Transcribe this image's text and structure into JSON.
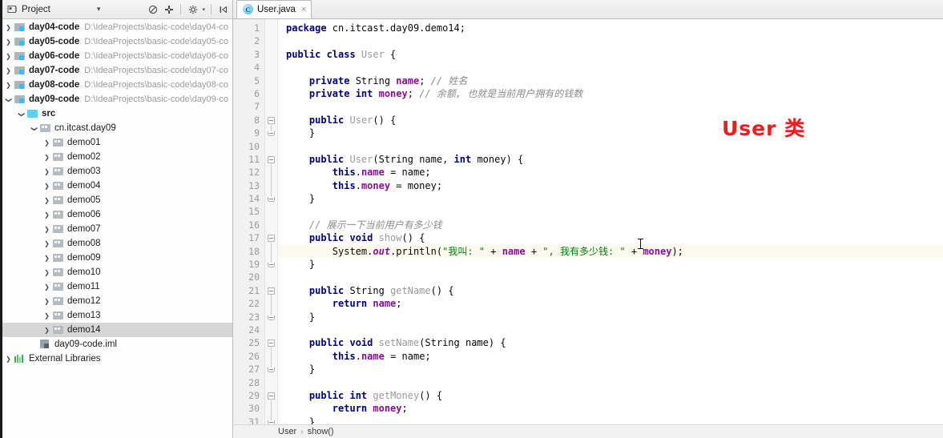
{
  "project_panel": {
    "title": "Project",
    "title_dropdown": "▾",
    "toolbar": [
      {
        "name": "collapse-all-icon",
        "glyph": "⊘"
      },
      {
        "name": "locate-target-icon",
        "glyph": "✥"
      },
      {
        "name": "settings-gear-icon",
        "glyph": "⚙"
      },
      {
        "name": "hide-panel-icon",
        "glyph": "⊢"
      }
    ],
    "tree": [
      {
        "label": "day04-code",
        "path": "D:\\IdeaProjects\\basic-code\\day04-co",
        "indent": 0,
        "twisty": "collapsed",
        "icon": "module",
        "bold": true,
        "selected": false
      },
      {
        "label": "day05-code",
        "path": "D:\\IdeaProjects\\basic-code\\day05-co",
        "indent": 0,
        "twisty": "collapsed",
        "icon": "module",
        "bold": true,
        "selected": false
      },
      {
        "label": "day06-code",
        "path": "D:\\IdeaProjects\\basic-code\\day06-co",
        "indent": 0,
        "twisty": "collapsed",
        "icon": "module",
        "bold": true,
        "selected": false
      },
      {
        "label": "day07-code",
        "path": "D:\\IdeaProjects\\basic-code\\day07-co",
        "indent": 0,
        "twisty": "collapsed",
        "icon": "module",
        "bold": true,
        "selected": false
      },
      {
        "label": "day08-code",
        "path": "D:\\IdeaProjects\\basic-code\\day08-co",
        "indent": 0,
        "twisty": "collapsed",
        "icon": "module",
        "bold": true,
        "selected": false
      },
      {
        "label": "day09-code",
        "path": "D:\\IdeaProjects\\basic-code\\day09-co",
        "indent": 0,
        "twisty": "expanded",
        "icon": "module",
        "bold": true,
        "selected": false
      },
      {
        "label": "src",
        "path": "",
        "indent": 1,
        "twisty": "expanded",
        "icon": "src",
        "bold": true,
        "selected": false
      },
      {
        "label": "cn.itcast.day09",
        "path": "",
        "indent": 2,
        "twisty": "expanded",
        "icon": "pkg",
        "bold": false,
        "selected": false
      },
      {
        "label": "demo01",
        "path": "",
        "indent": 3,
        "twisty": "collapsed",
        "icon": "pkg",
        "bold": false,
        "selected": false
      },
      {
        "label": "demo02",
        "path": "",
        "indent": 3,
        "twisty": "collapsed",
        "icon": "pkg",
        "bold": false,
        "selected": false
      },
      {
        "label": "demo03",
        "path": "",
        "indent": 3,
        "twisty": "collapsed",
        "icon": "pkg",
        "bold": false,
        "selected": false
      },
      {
        "label": "demo04",
        "path": "",
        "indent": 3,
        "twisty": "collapsed",
        "icon": "pkg",
        "bold": false,
        "selected": false
      },
      {
        "label": "demo05",
        "path": "",
        "indent": 3,
        "twisty": "collapsed",
        "icon": "pkg",
        "bold": false,
        "selected": false
      },
      {
        "label": "demo06",
        "path": "",
        "indent": 3,
        "twisty": "collapsed",
        "icon": "pkg",
        "bold": false,
        "selected": false
      },
      {
        "label": "demo07",
        "path": "",
        "indent": 3,
        "twisty": "collapsed",
        "icon": "pkg",
        "bold": false,
        "selected": false
      },
      {
        "label": "demo08",
        "path": "",
        "indent": 3,
        "twisty": "collapsed",
        "icon": "pkg",
        "bold": false,
        "selected": false
      },
      {
        "label": "demo09",
        "path": "",
        "indent": 3,
        "twisty": "collapsed",
        "icon": "pkg",
        "bold": false,
        "selected": false
      },
      {
        "label": "demo10",
        "path": "",
        "indent": 3,
        "twisty": "collapsed",
        "icon": "pkg",
        "bold": false,
        "selected": false
      },
      {
        "label": "demo11",
        "path": "",
        "indent": 3,
        "twisty": "collapsed",
        "icon": "pkg",
        "bold": false,
        "selected": false
      },
      {
        "label": "demo12",
        "path": "",
        "indent": 3,
        "twisty": "collapsed",
        "icon": "pkg",
        "bold": false,
        "selected": false
      },
      {
        "label": "demo13",
        "path": "",
        "indent": 3,
        "twisty": "collapsed",
        "icon": "pkg",
        "bold": false,
        "selected": false
      },
      {
        "label": "demo14",
        "path": "",
        "indent": 3,
        "twisty": "collapsed",
        "icon": "pkg",
        "bold": false,
        "selected": true
      },
      {
        "label": "day09-code.iml",
        "path": "",
        "indent": 2,
        "twisty": "none",
        "icon": "iml",
        "bold": false,
        "selected": false
      },
      {
        "label": "External Libraries",
        "path": "",
        "indent": 0,
        "twisty": "collapsed",
        "icon": "lib",
        "bold": false,
        "selected": false
      }
    ]
  },
  "editor": {
    "tab": {
      "label": "User.java",
      "class_icon_letter": "C",
      "close_glyph": "×"
    },
    "annotation": "User 类",
    "annotation_color": "#ee1c1c",
    "highlighted_line": 18,
    "lines": [
      {
        "n": 1,
        "tokens": [
          {
            "t": "package ",
            "c": "kw"
          },
          {
            "t": "cn.itcast.day09.demo14;",
            "c": "plain"
          }
        ]
      },
      {
        "n": 2,
        "tokens": []
      },
      {
        "n": 3,
        "tokens": [
          {
            "t": "public class ",
            "c": "kw"
          },
          {
            "t": "User ",
            "c": "cls"
          },
          {
            "t": "{",
            "c": "plain"
          }
        ]
      },
      {
        "n": 4,
        "tokens": []
      },
      {
        "n": 5,
        "tokens": [
          {
            "t": "    ",
            "c": "plain"
          },
          {
            "t": "private ",
            "c": "kw"
          },
          {
            "t": "String ",
            "c": "plain"
          },
          {
            "t": "name",
            "c": "fld"
          },
          {
            "t": "; ",
            "c": "plain"
          },
          {
            "t": "// 姓名",
            "c": "cmt"
          }
        ]
      },
      {
        "n": 6,
        "tokens": [
          {
            "t": "    ",
            "c": "plain"
          },
          {
            "t": "private int ",
            "c": "kw"
          },
          {
            "t": "money",
            "c": "fld"
          },
          {
            "t": "; ",
            "c": "plain"
          },
          {
            "t": "// 余额, 也就是当前用户拥有的钱数",
            "c": "cmt"
          }
        ]
      },
      {
        "n": 7,
        "tokens": []
      },
      {
        "n": 8,
        "tokens": [
          {
            "t": "    ",
            "c": "plain"
          },
          {
            "t": "public ",
            "c": "kw"
          },
          {
            "t": "User",
            "c": "cls"
          },
          {
            "t": "() {",
            "c": "plain"
          }
        ]
      },
      {
        "n": 9,
        "tokens": [
          {
            "t": "    }",
            "c": "plain"
          }
        ]
      },
      {
        "n": 10,
        "tokens": []
      },
      {
        "n": 11,
        "tokens": [
          {
            "t": "    ",
            "c": "plain"
          },
          {
            "t": "public ",
            "c": "kw"
          },
          {
            "t": "User",
            "c": "cls"
          },
          {
            "t": "(String name, ",
            "c": "plain"
          },
          {
            "t": "int ",
            "c": "kw"
          },
          {
            "t": "money) {",
            "c": "plain"
          }
        ]
      },
      {
        "n": 12,
        "tokens": [
          {
            "t": "        ",
            "c": "plain"
          },
          {
            "t": "this",
            "c": "kw"
          },
          {
            "t": ".",
            "c": "plain"
          },
          {
            "t": "name",
            "c": "fld"
          },
          {
            "t": " = name;",
            "c": "plain"
          }
        ]
      },
      {
        "n": 13,
        "tokens": [
          {
            "t": "        ",
            "c": "plain"
          },
          {
            "t": "this",
            "c": "kw"
          },
          {
            "t": ".",
            "c": "plain"
          },
          {
            "t": "money",
            "c": "fld"
          },
          {
            "t": " = money;",
            "c": "plain"
          }
        ]
      },
      {
        "n": 14,
        "tokens": [
          {
            "t": "    }",
            "c": "plain"
          }
        ]
      },
      {
        "n": 15,
        "tokens": []
      },
      {
        "n": 16,
        "tokens": [
          {
            "t": "    ",
            "c": "plain"
          },
          {
            "t": "// 展示一下当前用户有多少钱",
            "c": "cmt"
          }
        ]
      },
      {
        "n": 17,
        "tokens": [
          {
            "t": "    ",
            "c": "plain"
          },
          {
            "t": "public void ",
            "c": "kw"
          },
          {
            "t": "show",
            "c": "cls"
          },
          {
            "t": "() {",
            "c": "plain"
          }
        ]
      },
      {
        "n": 18,
        "tokens": [
          {
            "t": "        System.",
            "c": "plain"
          },
          {
            "t": "out",
            "c": "stat"
          },
          {
            "t": ".println(",
            "c": "plain"
          },
          {
            "t": "\"我叫: \"",
            "c": "str"
          },
          {
            "t": " + ",
            "c": "plain"
          },
          {
            "t": "name",
            "c": "fld"
          },
          {
            "t": " + ",
            "c": "plain"
          },
          {
            "t": "\", 我有多少钱: \"",
            "c": "str"
          },
          {
            "t": " + ",
            "c": "plain"
          },
          {
            "t": "money",
            "c": "fld"
          },
          {
            "t": ");",
            "c": "plain"
          }
        ]
      },
      {
        "n": 19,
        "tokens": [
          {
            "t": "    }",
            "c": "plain"
          }
        ]
      },
      {
        "n": 20,
        "tokens": []
      },
      {
        "n": 21,
        "tokens": [
          {
            "t": "    ",
            "c": "plain"
          },
          {
            "t": "public ",
            "c": "kw"
          },
          {
            "t": "String ",
            "c": "plain"
          },
          {
            "t": "getName",
            "c": "cls"
          },
          {
            "t": "() {",
            "c": "plain"
          }
        ]
      },
      {
        "n": 22,
        "tokens": [
          {
            "t": "        ",
            "c": "plain"
          },
          {
            "t": "return ",
            "c": "kw"
          },
          {
            "t": "name",
            "c": "fld"
          },
          {
            "t": ";",
            "c": "plain"
          }
        ]
      },
      {
        "n": 23,
        "tokens": [
          {
            "t": "    }",
            "c": "plain"
          }
        ]
      },
      {
        "n": 24,
        "tokens": []
      },
      {
        "n": 25,
        "tokens": [
          {
            "t": "    ",
            "c": "plain"
          },
          {
            "t": "public void ",
            "c": "kw"
          },
          {
            "t": "setName",
            "c": "cls"
          },
          {
            "t": "(String name) {",
            "c": "plain"
          }
        ]
      },
      {
        "n": 26,
        "tokens": [
          {
            "t": "        ",
            "c": "plain"
          },
          {
            "t": "this",
            "c": "kw"
          },
          {
            "t": ".",
            "c": "plain"
          },
          {
            "t": "name",
            "c": "fld"
          },
          {
            "t": " = name;",
            "c": "plain"
          }
        ]
      },
      {
        "n": 27,
        "tokens": [
          {
            "t": "    }",
            "c": "plain"
          }
        ]
      },
      {
        "n": 28,
        "tokens": []
      },
      {
        "n": 29,
        "tokens": [
          {
            "t": "    ",
            "c": "plain"
          },
          {
            "t": "public int ",
            "c": "kw"
          },
          {
            "t": "getMoney",
            "c": "cls"
          },
          {
            "t": "() {",
            "c": "plain"
          }
        ]
      },
      {
        "n": 30,
        "tokens": [
          {
            "t": "        ",
            "c": "plain"
          },
          {
            "t": "return ",
            "c": "kw"
          },
          {
            "t": "money",
            "c": "fld"
          },
          {
            "t": ";",
            "c": "plain"
          }
        ]
      },
      {
        "n": 31,
        "tokens": [
          {
            "t": "    }",
            "c": "plain"
          }
        ]
      }
    ],
    "fold_markers": [
      {
        "line": 8,
        "kind": "start"
      },
      {
        "line": 9,
        "kind": "end"
      },
      {
        "line": 11,
        "kind": "start"
      },
      {
        "line": 14,
        "kind": "end"
      },
      {
        "line": 17,
        "kind": "start"
      },
      {
        "line": 19,
        "kind": "end"
      },
      {
        "line": 21,
        "kind": "start"
      },
      {
        "line": 23,
        "kind": "end"
      },
      {
        "line": 25,
        "kind": "start"
      },
      {
        "line": 27,
        "kind": "end"
      },
      {
        "line": 29,
        "kind": "start"
      },
      {
        "line": 31,
        "kind": "end"
      }
    ],
    "breadcrumb": {
      "items": [
        "User",
        "show()"
      ],
      "separator": "›"
    }
  }
}
